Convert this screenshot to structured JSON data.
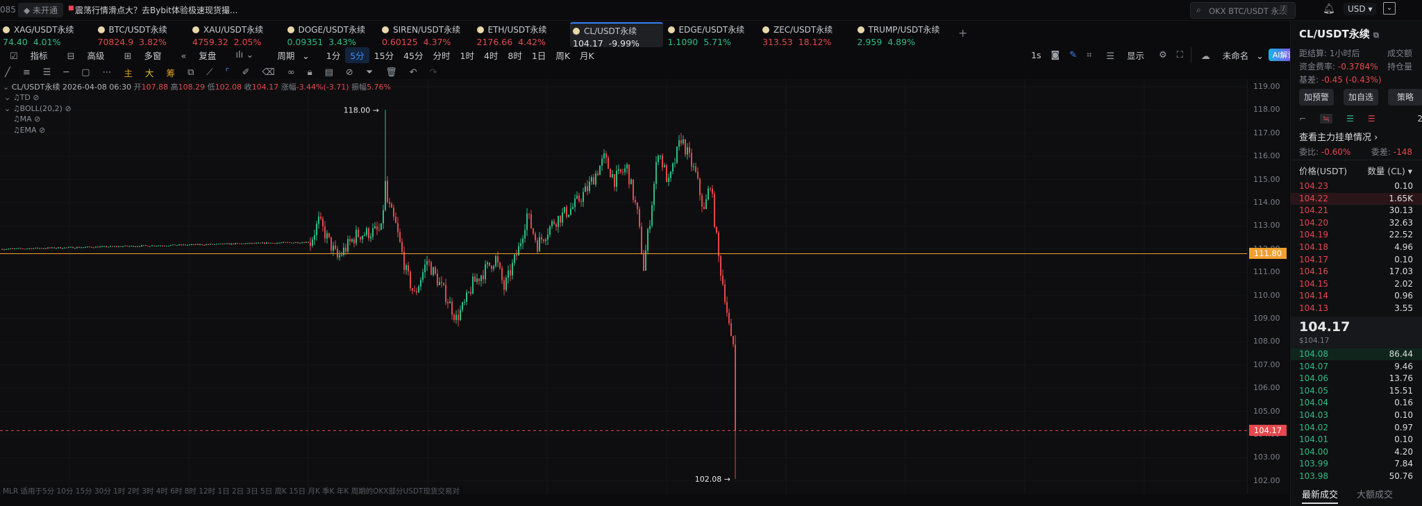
{
  "topbar": {
    "left_fragment": "085",
    "status_badge": "未开通",
    "news": "震荡行情滑点大？去Bybit体验极速现货撮...",
    "search_placeholder": "OKX BTC/USDT 永续",
    "search_shortcut": "/",
    "currency": "USD"
  },
  "tickers": [
    {
      "name": "XAG/USDT永续",
      "price": "74.40",
      "change": "4.01%",
      "dir": "up"
    },
    {
      "name": "BTC/USDT永续",
      "price": "70824.9",
      "change": "3.82%",
      "dir": "down"
    },
    {
      "name": "XAU/USDT永续",
      "price": "4759.32",
      "change": "2.05%",
      "dir": "down"
    },
    {
      "name": "DOGE/USDT永续",
      "price": "0.09351",
      "change": "3.43%",
      "dir": "up"
    },
    {
      "name": "SIREN/USDT永续",
      "price": "0.60125",
      "change": "4.37%",
      "dir": "down"
    },
    {
      "name": "ETH/USDT永续",
      "price": "2176.66",
      "change": "4.42%",
      "dir": "down"
    },
    {
      "name": "CL/USDT永续",
      "price": "104.17",
      "change": "-9.99%",
      "dir": "active"
    },
    {
      "name": "EDGE/USDT永续",
      "price": "1.1090",
      "change": "5.71%",
      "dir": "up"
    },
    {
      "name": "ZEC/USDT永续",
      "price": "313.53",
      "change": "18.12%",
      "dir": "down"
    },
    {
      "name": "TRUMP/USDT永续",
      "price": "2.959",
      "change": "4.89%",
      "dir": "up"
    }
  ],
  "add_tab": "+",
  "toolbar": {
    "indicators": "指标",
    "advanced": "高级",
    "multi": "多窗",
    "replay": "复盘",
    "period": "周期",
    "intervals": [
      "1分",
      "5分",
      "15分",
      "45分",
      "分时",
      "1时",
      "4时",
      "8时",
      "1日",
      "周K",
      "月K"
    ],
    "active_interval": "5分",
    "speed": "1s",
    "display": "显示",
    "layout_name": "未命名",
    "ai": "AI解读",
    "draw_main": "主",
    "draw_big": "大",
    "draw_chips": "筹"
  },
  "ohlc": {
    "symbol": "CL/USDT永续",
    "time": "2026-04-08 06:30",
    "open_label": "开",
    "open": "107.88",
    "high_label": "高",
    "high": "108.29",
    "low_label": "低",
    "low": "102.08",
    "close_label": "收",
    "close": "104.17",
    "chg_label": "涨幅",
    "chg": "-3.44%(-3.71)",
    "amp_label": "振幅",
    "amp": "5.76%"
  },
  "indicators": [
    "TD",
    "BOLL(20,2)",
    "MA",
    "EMA"
  ],
  "chart_data": {
    "type": "candlestick",
    "ylim": [
      101.5,
      119.5
    ],
    "ticks": [
      "119.00",
      "118.00",
      "117.00",
      "116.00",
      "115.00",
      "114.00",
      "113.00",
      "112.00",
      "111.00",
      "110.00",
      "109.00",
      "108.00",
      "107.00",
      "106.00",
      "105.00",
      "104.00",
      "103.00",
      "102.00"
    ],
    "waypoints": [
      [
        0,
        112.0
      ],
      [
        148,
        112.3
      ],
      [
        152,
        113.2
      ],
      [
        161,
        111.6
      ],
      [
        170,
        112.6
      ],
      [
        182,
        112.8
      ],
      [
        184,
        114.8
      ],
      [
        185,
        114
      ],
      [
        189,
        113
      ],
      [
        194,
        111
      ],
      [
        198,
        110
      ],
      [
        204,
        111.5
      ],
      [
        213,
        110
      ],
      [
        218,
        109
      ],
      [
        222,
        109.6
      ],
      [
        226,
        110.5
      ],
      [
        237,
        111.6
      ],
      [
        241,
        110.3
      ],
      [
        248,
        112
      ],
      [
        252,
        113.5
      ],
      [
        257,
        112.2
      ],
      [
        265,
        113.2
      ],
      [
        274,
        113.8
      ],
      [
        281,
        114.6
      ],
      [
        289,
        115.9
      ],
      [
        294,
        115
      ],
      [
        300,
        115.5
      ],
      [
        305,
        113.5
      ],
      [
        308,
        111.2
      ],
      [
        311,
        113.3
      ],
      [
        315,
        116.3
      ],
      [
        320,
        114.8
      ],
      [
        326,
        116.8
      ],
      [
        333,
        115.2
      ],
      [
        337,
        113.6
      ],
      [
        340,
        114.9
      ],
      [
        344,
        111.6
      ],
      [
        347,
        110
      ],
      [
        350,
        108
      ],
      [
        351,
        107.88
      ]
    ],
    "spikes": [
      [
        184,
        118.0
      ],
      [
        326,
        117.0
      ]
    ],
    "last_candle": {
      "open": 107.88,
      "high": 108.29,
      "low": 102.08,
      "close": 104.17
    },
    "max_label": "118.00",
    "min_label": "102.08",
    "hline_price": 111.8,
    "hline_label": "111.80",
    "last_price": 104.17,
    "last_label": "104.17"
  },
  "footer": "MLR 适用于5分 10分 15分 30分 1时 2时 3时 4时 6时 8时 12时 1日 2日 3日 5日 周K 15日 月K 季K 年K 周期的OKX部分USDT现货交易对",
  "panel": {
    "title": "CL/USDT永续",
    "settle_label": "距结算:",
    "settle": "1小时后",
    "turnover_label": "成交额",
    "funding_label": "资金费率:",
    "funding": "-0.3784%",
    "oi_label": "持仓量",
    "basis_label": "基差:",
    "basis": "-0.45 (-0.43%)",
    "buttons": [
      "加预警",
      "加自选",
      "策略"
    ],
    "depth_step": "2",
    "main_orders": "查看主力挂单情况 ›",
    "ratio_label": "委比:",
    "ratio": "-0.60%",
    "diff_label": "委差:",
    "diff": "-148",
    "col_price": "价格(USDT)",
    "col_qty": "数量 (CL) ▾",
    "asks": [
      [
        "104.23",
        "0.10"
      ],
      [
        "104.22",
        "1.65K"
      ],
      [
        "104.21",
        "30.13"
      ],
      [
        "104.20",
        "32.63"
      ],
      [
        "104.19",
        "22.52"
      ],
      [
        "104.18",
        "4.96"
      ],
      [
        "104.17",
        "0.10"
      ],
      [
        "104.16",
        "17.03"
      ],
      [
        "104.15",
        "2.02"
      ],
      [
        "104.14",
        "0.96"
      ],
      [
        "104.13",
        "3.55"
      ]
    ],
    "last": "104.17",
    "last_usd": "$104.17",
    "bids": [
      [
        "104.08",
        "86.44"
      ],
      [
        "104.07",
        "9.46"
      ],
      [
        "104.06",
        "13.76"
      ],
      [
        "104.05",
        "15.51"
      ],
      [
        "104.04",
        "0.16"
      ],
      [
        "104.03",
        "0.10"
      ],
      [
        "104.02",
        "0.97"
      ],
      [
        "104.01",
        "0.10"
      ],
      [
        "104.00",
        "4.20"
      ],
      [
        "103.99",
        "7.84"
      ],
      [
        "103.98",
        "50.76"
      ]
    ],
    "tab_latest": "最新成交",
    "tab_large": "大额成交"
  },
  "colors": {
    "up": "#2ebd85",
    "down": "#e5484d",
    "accent": "#3b8bf5",
    "hline": "#f0a030"
  }
}
